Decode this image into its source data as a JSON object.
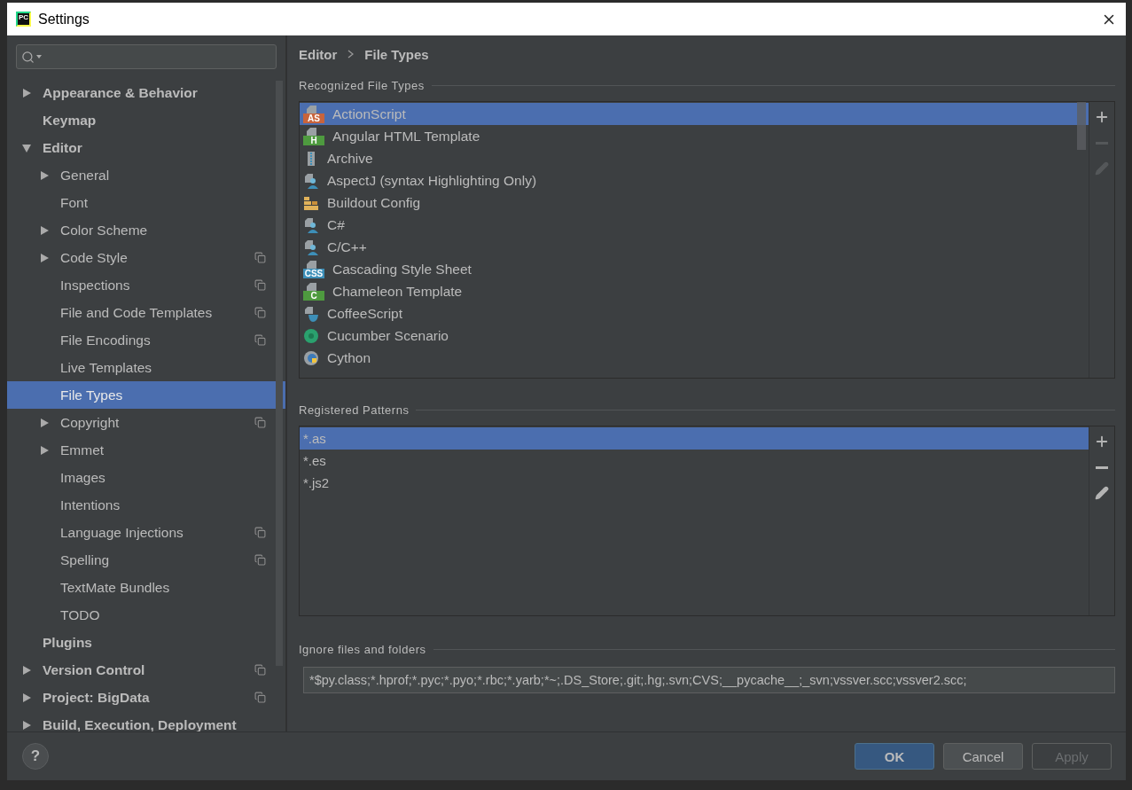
{
  "window": {
    "title": "Settings",
    "logo_text": "PC"
  },
  "tree": [
    {
      "label": "Appearance & Behavior",
      "expandable": true,
      "expanded": false,
      "project": false,
      "selected": false
    },
    {
      "label": "Keymap",
      "expandable": false,
      "project": false,
      "selected": false
    },
    {
      "label": "Editor",
      "expandable": true,
      "expanded": true,
      "project": false,
      "selected": false,
      "children": [
        {
          "label": "General",
          "expandable": true,
          "expanded": false,
          "project": false,
          "selected": false
        },
        {
          "label": "Font",
          "expandable": false,
          "project": false,
          "selected": false
        },
        {
          "label": "Color Scheme",
          "expandable": true,
          "expanded": false,
          "project": false,
          "selected": false
        },
        {
          "label": "Code Style",
          "expandable": true,
          "expanded": false,
          "project": true,
          "selected": false
        },
        {
          "label": "Inspections",
          "expandable": false,
          "project": true,
          "selected": false
        },
        {
          "label": "File and Code Templates",
          "expandable": false,
          "project": true,
          "selected": false
        },
        {
          "label": "File Encodings",
          "expandable": false,
          "project": true,
          "selected": false
        },
        {
          "label": "Live Templates",
          "expandable": false,
          "project": false,
          "selected": false
        },
        {
          "label": "File Types",
          "expandable": false,
          "project": false,
          "selected": true
        },
        {
          "label": "Copyright",
          "expandable": true,
          "expanded": false,
          "project": true,
          "selected": false
        },
        {
          "label": "Emmet",
          "expandable": true,
          "expanded": false,
          "project": false,
          "selected": false
        },
        {
          "label": "Images",
          "expandable": false,
          "project": false,
          "selected": false
        },
        {
          "label": "Intentions",
          "expandable": false,
          "project": false,
          "selected": false
        },
        {
          "label": "Language Injections",
          "expandable": false,
          "project": true,
          "selected": false
        },
        {
          "label": "Spelling",
          "expandable": false,
          "project": true,
          "selected": false
        },
        {
          "label": "TextMate Bundles",
          "expandable": false,
          "project": false,
          "selected": false
        },
        {
          "label": "TODO",
          "expandable": false,
          "project": false,
          "selected": false
        }
      ]
    },
    {
      "label": "Plugins",
      "expandable": false,
      "project": false,
      "selected": false
    },
    {
      "label": "Version Control",
      "expandable": true,
      "expanded": false,
      "project": true,
      "selected": false
    },
    {
      "label": "Project: BigData",
      "expandable": true,
      "expanded": false,
      "project": true,
      "selected": false
    },
    {
      "label": "Build, Execution, Deployment",
      "expandable": true,
      "expanded": false,
      "project": false,
      "selected": false
    }
  ],
  "breadcrumb": [
    "Editor",
    "File Types"
  ],
  "recognized": {
    "title": "Recognized File Types",
    "items": [
      {
        "label": "ActionScript",
        "kind": "badge",
        "badge": "AS",
        "color": "#c8643c",
        "selected": true
      },
      {
        "label": "Angular HTML Template",
        "kind": "badge",
        "badge": "H",
        "color": "#4e9a3f",
        "selected": false
      },
      {
        "label": "Archive",
        "kind": "archive",
        "selected": false
      },
      {
        "label": "AspectJ (syntax Highlighting Only)",
        "kind": "person",
        "selected": false
      },
      {
        "label": "Buildout Config",
        "kind": "bricks",
        "selected": false
      },
      {
        "label": "C#",
        "kind": "person",
        "selected": false
      },
      {
        "label": "C/C++",
        "kind": "person",
        "selected": false
      },
      {
        "label": "Cascading Style Sheet",
        "kind": "badge",
        "badge": "CSS",
        "color": "#3d8fb8",
        "selected": false
      },
      {
        "label": "Chameleon Template",
        "kind": "badge",
        "badge": "C",
        "color": "#4e9a3f",
        "selected": false
      },
      {
        "label": "CoffeeScript",
        "kind": "coffee",
        "selected": false
      },
      {
        "label": "Cucumber Scenario",
        "kind": "cucumber",
        "selected": false
      },
      {
        "label": "Cython",
        "kind": "cython",
        "selected": false
      }
    ],
    "tools": [
      {
        "kind": "add",
        "disabled": false
      },
      {
        "kind": "remove",
        "disabled": true
      },
      {
        "kind": "edit",
        "disabled": true
      }
    ]
  },
  "patterns": {
    "title": "Registered Patterns",
    "items": [
      {
        "label": "*.as",
        "selected": true
      },
      {
        "label": "*.es",
        "selected": false
      },
      {
        "label": "*.js2",
        "selected": false
      }
    ],
    "tools": [
      {
        "kind": "add",
        "disabled": false
      },
      {
        "kind": "remove",
        "disabled": false
      },
      {
        "kind": "edit",
        "disabled": false
      }
    ]
  },
  "ignore": {
    "title": "Ignore files and folders",
    "value": "*$py.class;*.hprof;*.pyc;*.pyo;*.rbc;*.yarb;*~;.DS_Store;.git;.hg;.svn;CVS;__pycache__;_svn;vssver.scc;vssver2.scc;"
  },
  "help": "?",
  "buttons": [
    {
      "label": "OK",
      "kind": "primary",
      "disabled": false
    },
    {
      "label": "Cancel",
      "kind": "normal",
      "disabled": false
    },
    {
      "label": "Apply",
      "kind": "normal",
      "disabled": true
    }
  ]
}
